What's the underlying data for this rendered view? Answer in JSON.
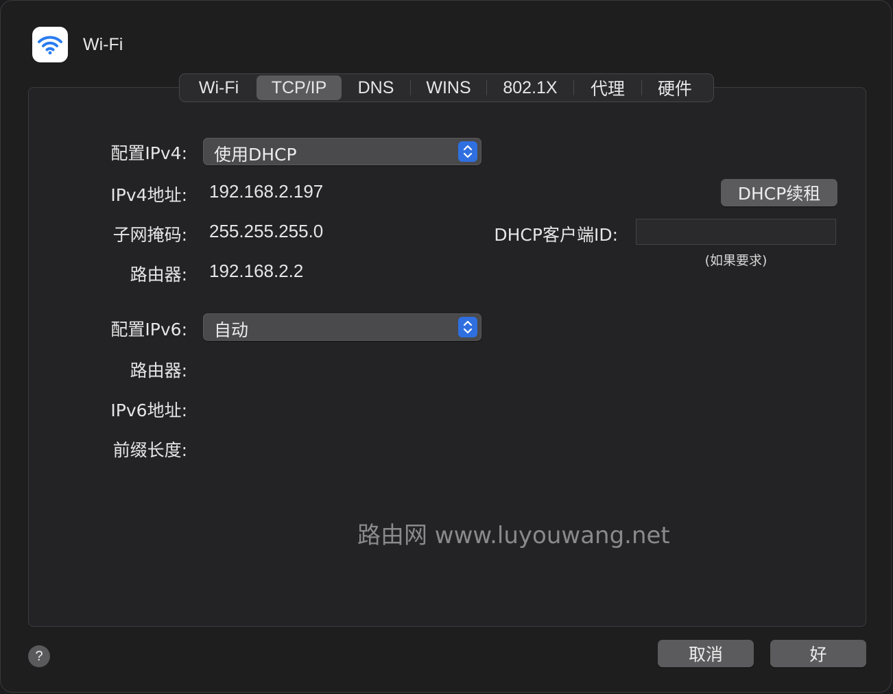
{
  "window": {
    "title": "Wi-Fi",
    "app_icon": "wifi-icon"
  },
  "tabs": [
    {
      "label": "Wi-Fi",
      "active": false
    },
    {
      "label": "TCP/IP",
      "active": true
    },
    {
      "label": "DNS",
      "active": false
    },
    {
      "label": "WINS",
      "active": false
    },
    {
      "label": "802.1X",
      "active": false
    },
    {
      "label": "代理",
      "active": false
    },
    {
      "label": "硬件",
      "active": false
    }
  ],
  "ipv4": {
    "config_label": "配置IPv4:",
    "config_value": "使用DHCP",
    "address_label": "IPv4地址:",
    "address_value": "192.168.2.197",
    "subnet_label": "子网掩码:",
    "subnet_value": "255.255.255.0",
    "router_label": "路由器:",
    "router_value": "192.168.2.2"
  },
  "dhcp": {
    "renew_button": "DHCP续租",
    "client_id_label": "DHCP客户端ID:",
    "client_id_value": "",
    "client_id_hint": "(如果要求)"
  },
  "ipv6": {
    "config_label": "配置IPv6:",
    "config_value": "自动",
    "router_label": "路由器:",
    "address_label": "IPv6地址:",
    "prefix_label": "前缀长度:"
  },
  "watermark": "路由网 www.luyouwang.net",
  "footer": {
    "help": "?",
    "cancel": "取消",
    "ok": "好"
  },
  "colors": {
    "accent": "#2f6fe0",
    "wifi_icon": "#2a7cf0"
  }
}
